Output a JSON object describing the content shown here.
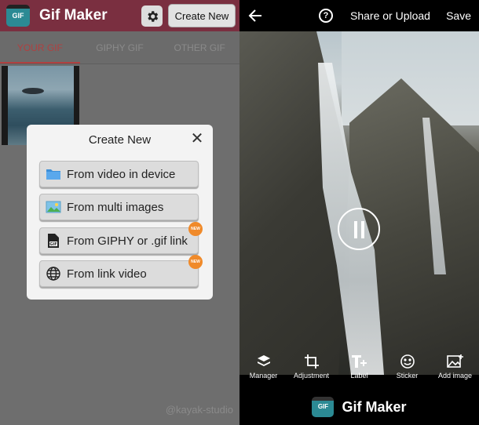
{
  "left": {
    "app_title": "Gif Maker",
    "logo_text": "GIF",
    "create_new_label": "Create New",
    "tabs": [
      {
        "label": "YOUR GIF",
        "active": true
      },
      {
        "label": "GIPHY GIF",
        "active": false
      },
      {
        "label": "OTHER GIF",
        "active": false
      }
    ],
    "watermark": "@kayak-studio"
  },
  "dialog": {
    "title": "Create New",
    "options": [
      {
        "label": "From video in device",
        "icon": "folder-icon",
        "new": false
      },
      {
        "label": "From multi images",
        "icon": "images-icon",
        "new": false
      },
      {
        "label": "From GIPHY or .gif link",
        "icon": "gif-file-icon",
        "new": true
      },
      {
        "label": "From link video",
        "icon": "globe-icon",
        "new": true
      }
    ],
    "badge_text": "NEW"
  },
  "right": {
    "share_label": "Share or Upload",
    "save_label": "Save",
    "help_text": "?",
    "tools": [
      {
        "label": "Manager",
        "icon": "layers-icon"
      },
      {
        "label": "Adjustment",
        "icon": "crop-icon"
      },
      {
        "label": "Label",
        "icon": "text-plus-icon"
      },
      {
        "label": "Sticker",
        "icon": "smiley-icon"
      },
      {
        "label": "Add image",
        "icon": "add-image-icon"
      }
    ],
    "brand_name": "Gif Maker",
    "brand_logo_text": "GIF"
  },
  "colors": {
    "topbar": "#7a2f40",
    "active_tab": "#b04040",
    "new_badge": "#f08a2a",
    "logo": "#2b8a94"
  }
}
